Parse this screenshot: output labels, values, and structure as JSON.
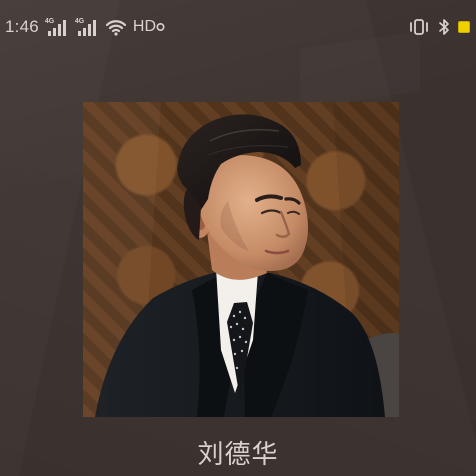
{
  "status_bar": {
    "time": "1:46",
    "network_badge_1": "4G",
    "network_badge_2": "4G",
    "hd_label": "HD",
    "icons": {
      "signal_1": "signal-4g-icon",
      "signal_2": "signal-4g-icon",
      "wifi": "wifi-icon",
      "hd": "hd-icon",
      "vibrate": "vibrate-icon",
      "bluetooth": "bluetooth-icon",
      "battery": "battery-icon"
    },
    "battery_color": "#f0d100"
  },
  "artist": {
    "name": "刘德华"
  },
  "colors": {
    "background": "#3f3532",
    "text": "#d8d2ce",
    "accent_battery": "#f0d100"
  }
}
